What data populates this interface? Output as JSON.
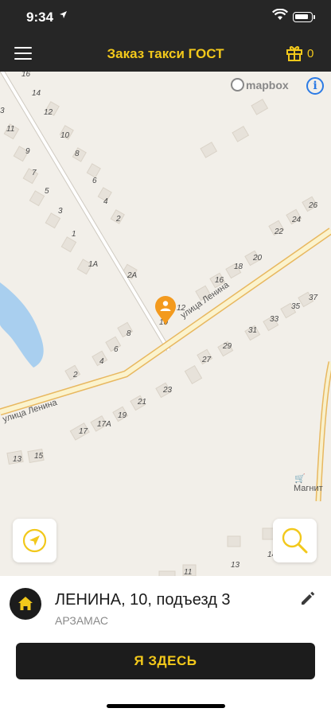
{
  "status": {
    "time": "9:34"
  },
  "nav": {
    "title": "Заказ такси ГОСТ",
    "gift_count": "0"
  },
  "map": {
    "attribution": "mapbox",
    "info": "i",
    "street_label": "улица Ленина",
    "street_label_2": "улица Ленина",
    "poi": "Магнит",
    "house_numbers": [
      "16",
      "14",
      "12",
      "10",
      "8",
      "6",
      "4",
      "2",
      "11",
      "9",
      "7",
      "5",
      "3",
      "1",
      "1А",
      "2А",
      "8",
      "6",
      "4",
      "2",
      "10",
      "12",
      "16",
      "18",
      "20",
      "22",
      "24",
      "26",
      "35",
      "37",
      "33",
      "31",
      "29",
      "27",
      "23",
      "21",
      "19",
      "17А",
      "17",
      "13",
      "15",
      "13",
      "14",
      "11",
      "3"
    ]
  },
  "sheet": {
    "address": "ЛЕНИНА, 10, подъезд 3",
    "city": "АРЗАМАС",
    "confirm_label": "Я ЗДЕСЬ"
  },
  "icons": {
    "menu": "menu-icon",
    "gift": "gift-icon",
    "home": "home-icon",
    "edit": "pencil-icon",
    "locate": "navigation-arrow-icon",
    "search": "magnifier-icon",
    "pin": "user-pin-icon"
  },
  "colors": {
    "bar": "#262626",
    "accent": "#f2c81b",
    "road_border": "#e8b860",
    "water": "#a9cfef",
    "pin": "#f39a1e"
  }
}
